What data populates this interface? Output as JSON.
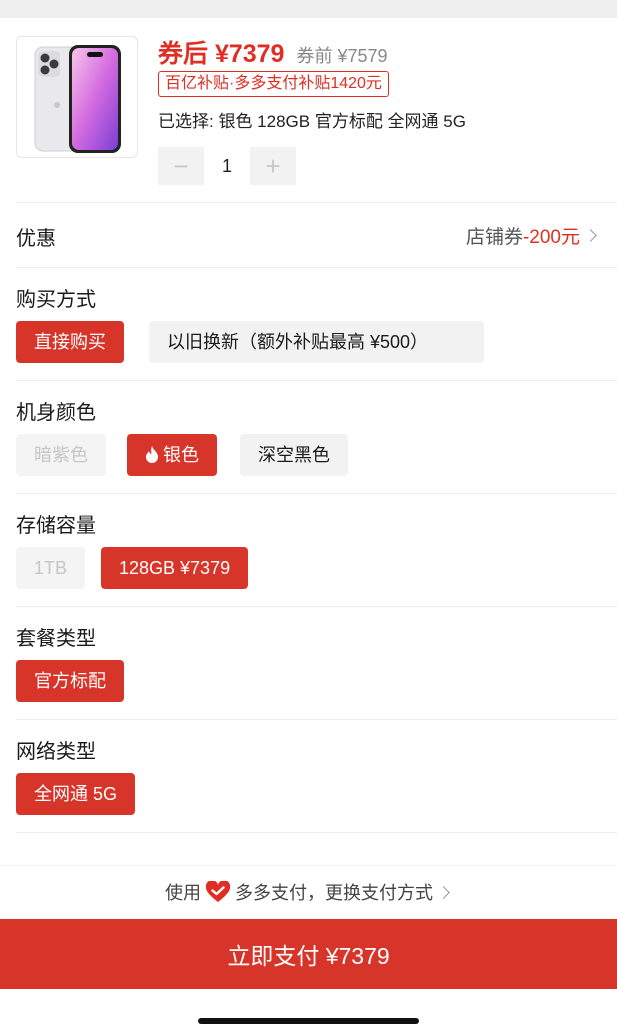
{
  "product": {
    "image_icon": "silver-phone-product-image",
    "price_after_coupon": "券后 ¥7379",
    "price_before_coupon": "券前 ¥7579",
    "subsidy_tag": "百亿补贴·多多支付补贴1420元",
    "selected_info": "已选择: 银色 128GB 官方标配 全网通 5G",
    "quantity": "1",
    "qty_minus": "−",
    "qty_plus": "+"
  },
  "coupon": {
    "label": "优惠",
    "store_coupon_text": "店铺券",
    "amount": "-200元"
  },
  "purchase_method": {
    "title": "购买方式",
    "options": [
      "直接购买",
      "以旧换新（额外补贴最高 ¥500）"
    ],
    "selected": "直接购买"
  },
  "color": {
    "title": "机身颜色",
    "options": [
      "暗紫色",
      "银色",
      "深空黑色"
    ],
    "selected": "银色",
    "disabled": [
      "暗紫色"
    ]
  },
  "storage": {
    "title": "存储容量",
    "options": [
      "1TB",
      "128GB ¥7379"
    ],
    "selected": "128GB ¥7379",
    "disabled": [
      "1TB"
    ]
  },
  "package": {
    "title": "套餐类型",
    "options": [
      "官方标配"
    ],
    "selected": "官方标配"
  },
  "network": {
    "title": "网络类型",
    "options": [
      "全网通 5G"
    ],
    "selected": "全网通 5G"
  },
  "payment": {
    "use_prefix": "使用",
    "method_icon": "heart-pay-icon",
    "method_text": "多多支付，更换支付方式",
    "pay_button": "立即支付 ¥7379"
  },
  "colors": {
    "accent": "#e02e24",
    "button_red": "#d8352a"
  }
}
